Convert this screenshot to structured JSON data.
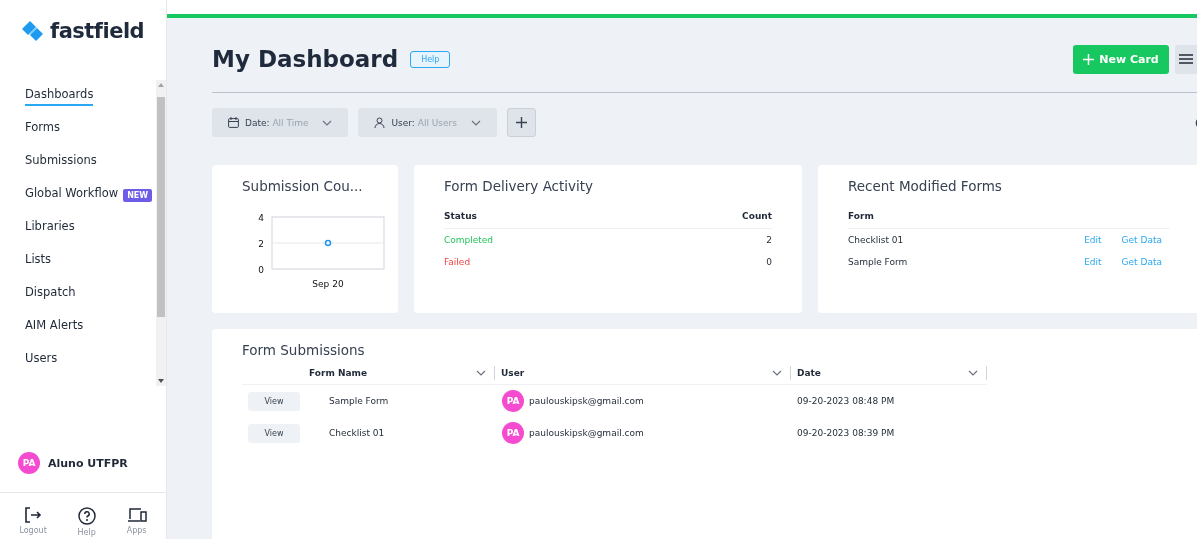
{
  "sidebar": {
    "logo": "fastfield",
    "items": [
      {
        "label": "Dashboards",
        "selected": true
      },
      {
        "label": "Forms",
        "selected": false
      },
      {
        "label": "Submissions",
        "selected": false
      },
      {
        "label": "Global Workflow",
        "selected": false,
        "badge": "NEW"
      },
      {
        "label": "Libraries",
        "selected": false
      },
      {
        "label": "Lists",
        "selected": false
      },
      {
        "label": "Dispatch",
        "selected": false
      },
      {
        "label": "AIM Alerts",
        "selected": false
      },
      {
        "label": "Users",
        "selected": false
      }
    ],
    "profile": {
      "initials": "PA",
      "name": "Aluno UTFPR"
    },
    "footer": [
      {
        "kind": "logout",
        "label": "Logout"
      },
      {
        "kind": "help",
        "label": "Help"
      },
      {
        "kind": "apps",
        "label": "Apps"
      }
    ]
  },
  "header": {
    "title": "My Dashboard",
    "help": "Help",
    "new_card": "New Card"
  },
  "filters": [
    {
      "kind": "date",
      "label": "Date:",
      "value": "All Time"
    },
    {
      "kind": "user",
      "label": "User:",
      "value": "All Users"
    }
  ],
  "submission_count": {
    "title": "Submission Cou...",
    "chart_data": {
      "type": "line",
      "categories": [
        "Sep 20"
      ],
      "series": [
        {
          "color": "#2196f3",
          "marker": "circle",
          "values": [
            2
          ]
        }
      ],
      "ylim": [
        0,
        4
      ],
      "yticks": [
        0,
        2,
        4
      ]
    }
  },
  "delivery": {
    "title": "Form Delivery Activity",
    "columns": [
      "Status",
      "Count"
    ],
    "rows": [
      {
        "status": "Completed",
        "kind": "completed",
        "count": "2"
      },
      {
        "status": "Failed",
        "kind": "failed",
        "count": "0"
      }
    ]
  },
  "recent": {
    "title": "Recent Modified Forms",
    "column": "Form",
    "rows": [
      {
        "form": "Checklist 01",
        "edit": "Edit",
        "get_data": "Get Data"
      },
      {
        "form": "Sample Form",
        "edit": "Edit",
        "get_data": "Get Data"
      }
    ]
  },
  "submissions": {
    "title": "Form Submissions",
    "columns": [
      "Form Name",
      "User",
      "Date"
    ],
    "rows": [
      {
        "action": "View",
        "form": "Sample Form",
        "initials": "PA",
        "user": "paulouskipsk@gmail.com",
        "date": "09-20-2023 08:48 PM"
      },
      {
        "action": "View",
        "form": "Checklist 01",
        "initials": "PA",
        "user": "paulouskipsk@gmail.com",
        "date": "09-20-2023 08:39 PM"
      }
    ]
  }
}
